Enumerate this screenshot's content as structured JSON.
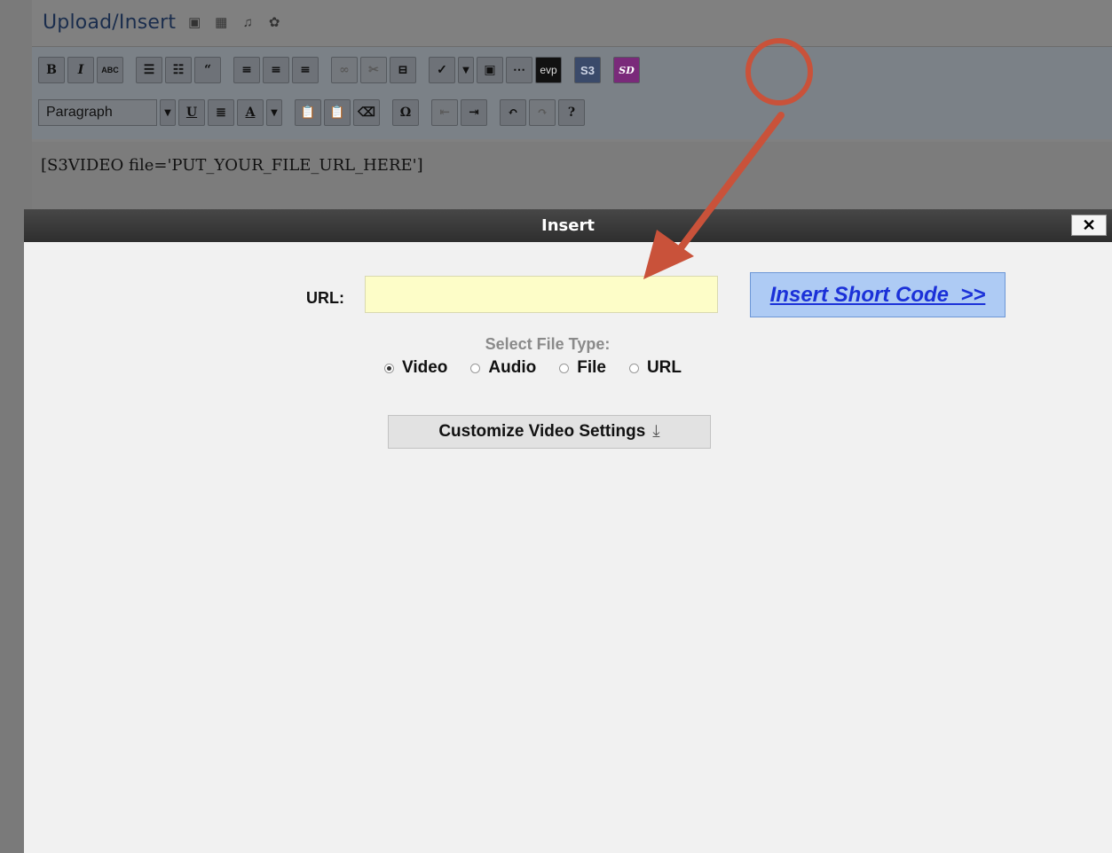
{
  "editor": {
    "upload_label": "Upload/Insert",
    "media_icons": [
      "image-icon",
      "video-icon",
      "audio-icon",
      "media-icon"
    ],
    "toolbar_row1": [
      "B",
      "I",
      "ABC"
    ],
    "format_value": "Paragraph",
    "toolbar_row2": [
      "U"
    ],
    "toolbar_evp": "evp",
    "toolbar_sd": "SD",
    "content_text": "[S3VIDEO file='PUT_YOUR_FILE_URL_HERE']"
  },
  "modal": {
    "title": "Insert",
    "close_label": "✕",
    "url_label": "URL:",
    "url_value": "",
    "url_placeholder": "",
    "insert_button_label": "Insert Short Code  >>",
    "file_type_label": "Select File Type:",
    "file_types": [
      {
        "label": "Video",
        "checked": true
      },
      {
        "label": "Audio",
        "checked": false
      },
      {
        "label": "File",
        "checked": false
      },
      {
        "label": "URL",
        "checked": false
      }
    ],
    "customize_label": "Customize Video Settings"
  },
  "colors": {
    "annotation": "#c9523a",
    "insert_link": "#1b31d8",
    "input_bg": "#fdfdc8"
  }
}
